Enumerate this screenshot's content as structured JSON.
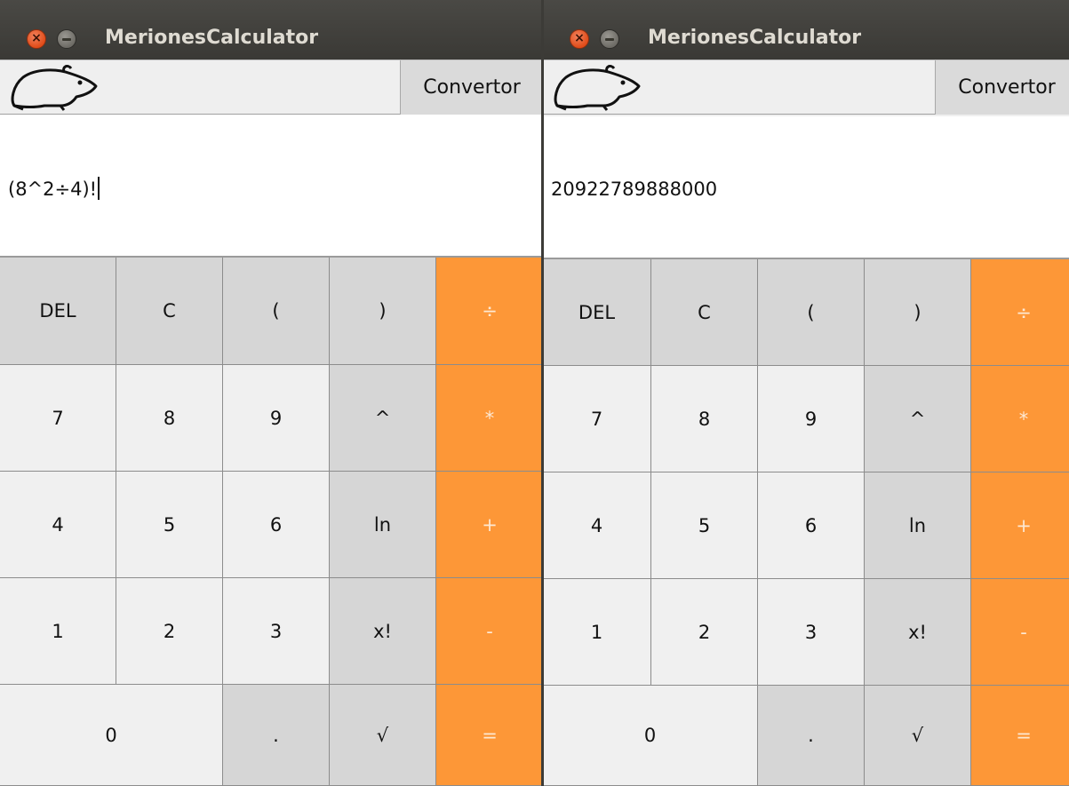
{
  "windows": [
    {
      "title": "MerionesCalculator",
      "convertor_label": "Convertor",
      "display_text": "(8^2÷4)!",
      "keys": {
        "del": "DEL",
        "c": "C",
        "lparen": "(",
        "rparen": ")",
        "div": "÷",
        "k7": "7",
        "k8": "8",
        "k9": "9",
        "pow": "^",
        "mul": "*",
        "k4": "4",
        "k5": "5",
        "k6": "6",
        "ln": "ln",
        "add": "+",
        "k1": "1",
        "k2": "2",
        "k3": "3",
        "fact": "x!",
        "sub": "-",
        "k0": "0",
        "dot": ".",
        "sqrt": "√",
        "eq": "="
      }
    },
    {
      "title": "MerionesCalculator",
      "convertor_label": "Convertor",
      "display_text": "20922789888000",
      "keys": {
        "del": "DEL",
        "c": "C",
        "lparen": "(",
        "rparen": ")",
        "div": "÷",
        "k7": "7",
        "k8": "8",
        "k9": "9",
        "pow": "^",
        "mul": "*",
        "k4": "4",
        "k5": "5",
        "k6": "6",
        "ln": "ln",
        "add": "+",
        "k1": "1",
        "k2": "2",
        "k3": "3",
        "fact": "x!",
        "sub": "-",
        "k0": "0",
        "dot": ".",
        "sqrt": "√",
        "eq": "="
      }
    }
  ],
  "colors": {
    "operator_key": "#fd9737",
    "function_key": "#d6d6d6",
    "digit_key": "#f0f0f0",
    "titlebar": "#3c3b37"
  },
  "icons": {
    "close": "close-icon",
    "minimize": "minimize-icon",
    "logo": "gerbil-logo-icon"
  }
}
